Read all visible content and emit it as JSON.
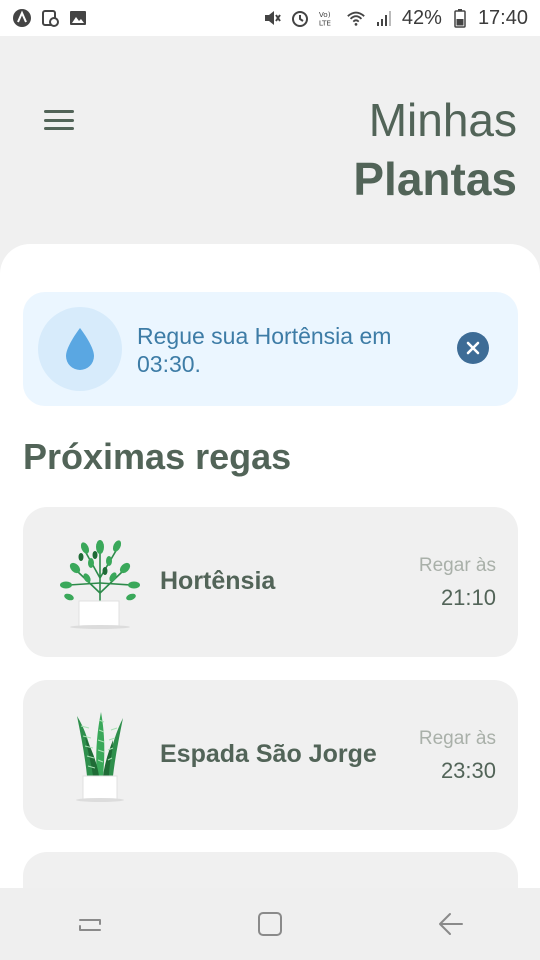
{
  "status_bar": {
    "battery_percent": "42%",
    "time": "17:40",
    "left_icons": [
      "app-logo-icon",
      "calendar-icon",
      "image-icon"
    ],
    "right_icons": [
      "mute-icon",
      "alarm-icon",
      "volte-icon",
      "wifi-icon",
      "signal-icon",
      "battery-icon"
    ]
  },
  "header": {
    "title_line1": "Minhas",
    "title_line2": "Plantas",
    "menu_icon": "hamburger-menu-icon"
  },
  "alert": {
    "text": "Regue sua Hortênsia em 03:30.",
    "icon": "water-drop-icon",
    "close_icon": "close-icon"
  },
  "section_title": "Próximas regas",
  "plants": [
    {
      "name": "Hortênsia",
      "water_label": "Regar às",
      "water_time": "21:10",
      "icon": "leafy-plant-icon"
    },
    {
      "name": "Espada São Jorge",
      "water_label": "Regar às",
      "water_time": "23:30",
      "icon": "snake-plant-icon"
    }
  ],
  "colors": {
    "primary_text": "#526458",
    "alert_bg": "#ebf6ff",
    "alert_text": "#3d7ca6",
    "card_bg": "#f0f0f0",
    "muted_text": "#a9b0a9"
  }
}
